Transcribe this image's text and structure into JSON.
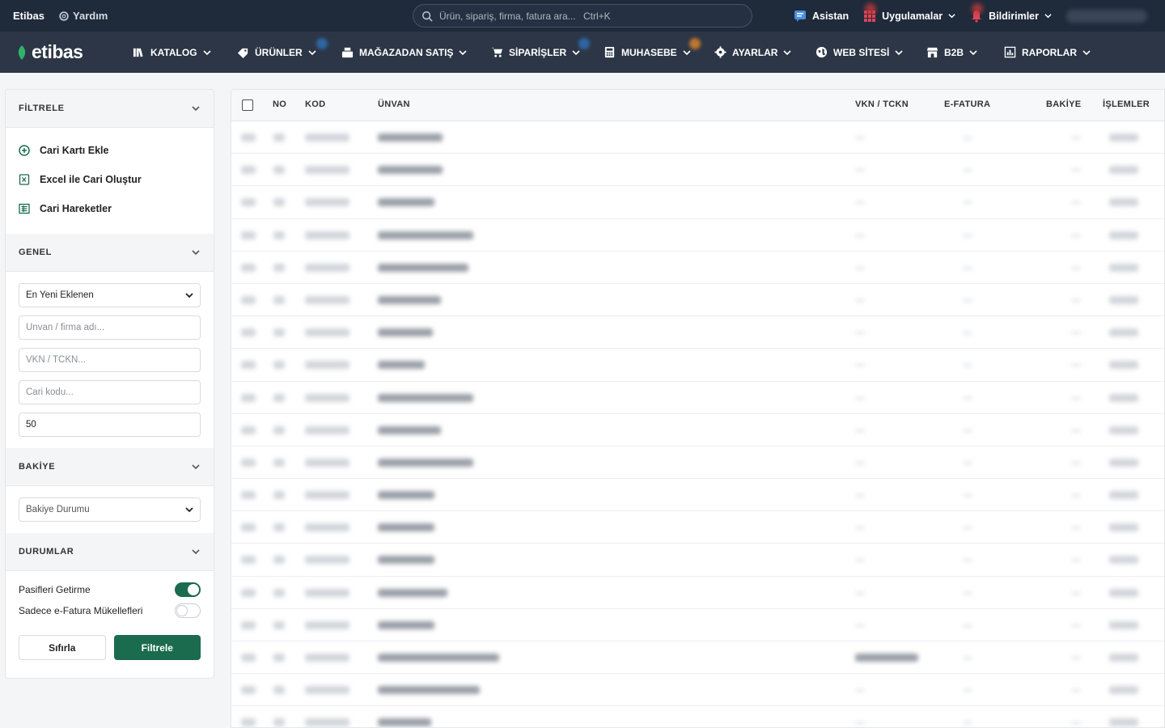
{
  "topbar": {
    "brand": "Etibas",
    "help": "Yardım",
    "search_placeholder": "Ürün, sipariş, firma, fatura ara...",
    "search_shortcut": "Ctrl+K",
    "assistant": "Asistan",
    "apps": "Uygulamalar",
    "notifications": "Bildirimler"
  },
  "logo": "etibas",
  "nav": {
    "items": [
      {
        "label": "KATALOG",
        "icon": "books-icon"
      },
      {
        "label": "ÜRÜNLER",
        "icon": "tag-icon"
      },
      {
        "label": "MAĞAZADAN SATIŞ",
        "icon": "cash-register-icon"
      },
      {
        "label": "SİPARİŞLER",
        "icon": "cart-icon"
      },
      {
        "label": "MUHASEBE",
        "icon": "calculator-icon"
      },
      {
        "label": "AYARLAR",
        "icon": "gear-icon"
      },
      {
        "label": "WEB SİTESİ",
        "icon": "globe-icon"
      },
      {
        "label": "B2B",
        "icon": "store-icon"
      },
      {
        "label": "RAPORLAR",
        "icon": "report-icon"
      }
    ],
    "badge_colors": {
      "urunler": "#2f6fb5",
      "siparisler": "#2f6fb5",
      "muhasebe": "#d9822b"
    }
  },
  "sidebar": {
    "filter_title": "FİLTRELE",
    "links": [
      "Cari Kartı Ekle",
      "Excel ile Cari Oluştur",
      "Cari Hareketler"
    ],
    "general_title": "GENEL",
    "sort_value": "En Yeni Eklenen",
    "title_placeholder": "Ünvan / firma adı...",
    "vkn_placeholder": "VKN / TCKN...",
    "code_placeholder": "Cari kodu...",
    "limit_value": "50",
    "balance_title": "BAKİYE",
    "balance_select": "Bakiye Durumu",
    "status_title": "DURUMLAR",
    "toggle1_label": "Pasifleri Getirme",
    "toggle2_label": "Sadece e-Fatura Mükellefleri",
    "toggle1_on": true,
    "toggle2_on": false,
    "reset_label": "Sıfırla",
    "filter_label": "Filtrele"
  },
  "table": {
    "headers": {
      "no": "NO",
      "kod": "KOD",
      "unvan": "ÜNVAN",
      "vkn": "VKN / TCKN",
      "efatura": "E-FATURA",
      "bakiye": "BAKİYE",
      "islemler": "İŞLEMLER"
    },
    "row_count": 19
  },
  "colors": {
    "accent": "#1b6b4f",
    "topbar": "#1f2a3a",
    "navbar": "#2c3646"
  }
}
